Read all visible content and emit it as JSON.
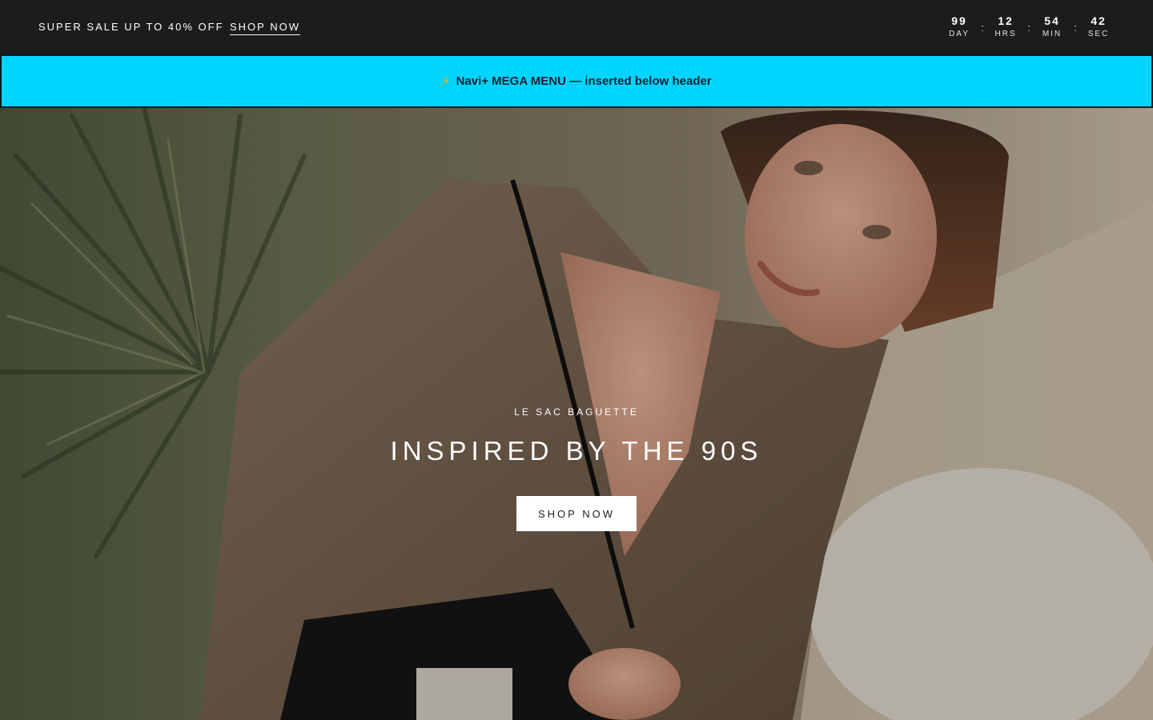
{
  "announcement": {
    "text": "SUPER SALE UP TO 40% OFF",
    "link_label": "SHOP NOW"
  },
  "countdown": {
    "units": [
      {
        "value": "99",
        "label": "DAY"
      },
      {
        "value": "12",
        "label": "HRS"
      },
      {
        "value": "54",
        "label": "MIN"
      },
      {
        "value": "42",
        "label": "SEC"
      }
    ],
    "separator": ":"
  },
  "navi_banner": {
    "icon": "lightning-icon",
    "icon_glyph": "⚡",
    "text": "Navi+ MEGA MENU — inserted below header",
    "background_color": "#00d4ff"
  },
  "hero": {
    "eyebrow": "LE SAC BAGUETTE",
    "title": "INSPIRED BY THE 90S",
    "button_label": "SHOP NOW"
  },
  "colors": {
    "announcement_bg": "#1c1c1c",
    "hero_button_bg": "#ffffff"
  }
}
